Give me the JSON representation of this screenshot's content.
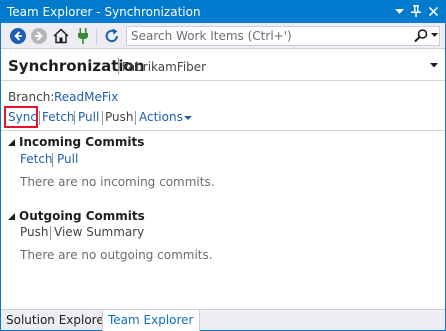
{
  "window": {
    "title": "Team Explorer - Synchronization",
    "buttons": {
      "dropdown": "▾",
      "pin": "🖈",
      "close": "✕"
    }
  },
  "toolbar": {
    "back_icon": "back-arrow-icon",
    "forward_icon": "forward-arrow-icon",
    "home_icon": "home-icon",
    "connect_icon": "plug-icon",
    "refresh_icon": "refresh-icon",
    "search": {
      "placeholder": "Search Work Items (Ctrl+')",
      "value": ""
    }
  },
  "header": {
    "title": "Synchronization",
    "project": "FabrikamFiber"
  },
  "branch": {
    "label": "Branch:",
    "name": "ReadMeFix"
  },
  "actions": {
    "sync": "Sync",
    "fetch": "Fetch",
    "pull": "Pull",
    "push": "Push",
    "more": "Actions"
  },
  "incoming": {
    "title": "Incoming Commits",
    "fetch": "Fetch",
    "pull": "Pull",
    "empty": "There are no incoming commits."
  },
  "outgoing": {
    "title": "Outgoing Commits",
    "push": "Push",
    "view_summary": "View Summary",
    "empty": "There are no outgoing commits."
  },
  "tabs": [
    {
      "label": "Solution Explorer",
      "active": false
    },
    {
      "label": "Team Explorer",
      "active": true
    }
  ],
  "colors": {
    "accent": "#007acc",
    "link": "#1e5fb4",
    "highlight": "#e8112d",
    "connect_green": "#388a34"
  }
}
